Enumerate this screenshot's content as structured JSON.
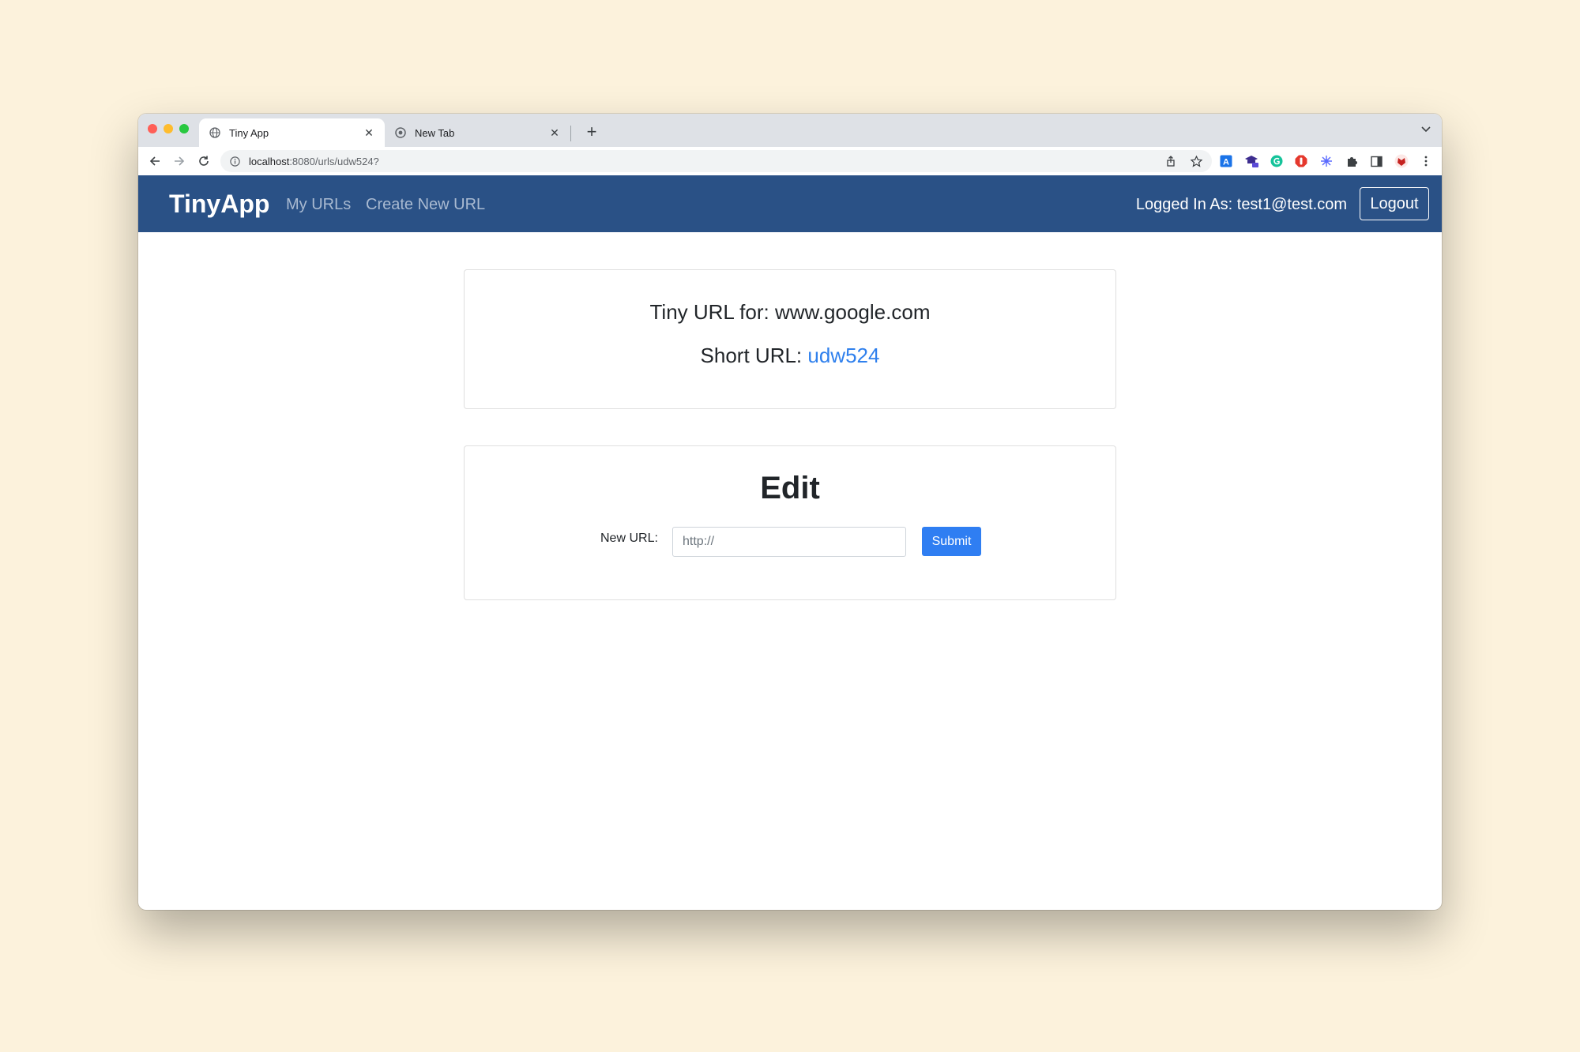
{
  "browser": {
    "tabs": [
      {
        "title": "Tiny App"
      },
      {
        "title": "New Tab"
      }
    ],
    "address": {
      "host": "localhost",
      "path": ":8080/urls/udw524?"
    }
  },
  "navbar": {
    "brand": "TinyApp",
    "links": [
      "My URLs",
      "Create New URL"
    ],
    "logged_in": "Logged In As: test1@test.com",
    "logout": "Logout"
  },
  "info_card": {
    "tiny_url_for": "Tiny URL for: www.google.com",
    "short_url_label": "Short URL: ",
    "short_url": "udw524"
  },
  "edit_card": {
    "title": "Edit",
    "label": "New URL:",
    "placeholder": "http://",
    "submit": "Submit"
  },
  "colors": {
    "navbar": "#2a5186",
    "link": "#2f80ed",
    "button": "#2f7ef2",
    "background": "#fcf2dc"
  }
}
